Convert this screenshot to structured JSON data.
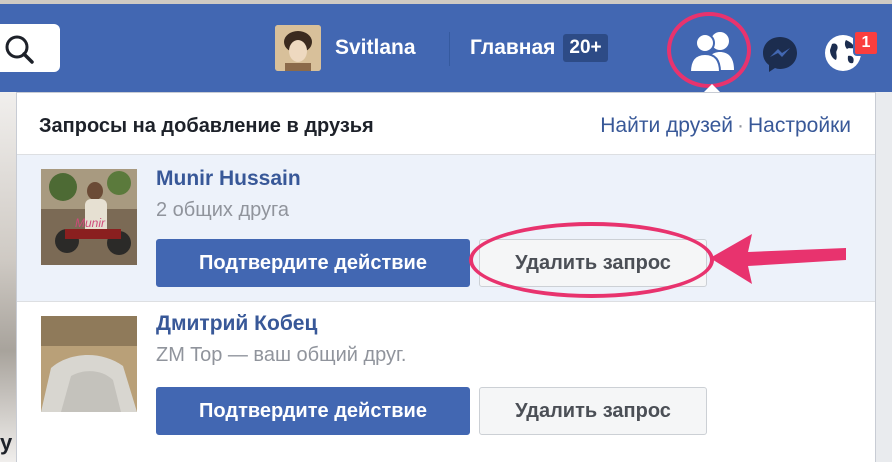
{
  "topbar": {
    "profile_name": "Svitlana",
    "home_label": "Главная",
    "home_badge": "20+",
    "notification_count": "1"
  },
  "panel": {
    "title": "Запросы на добавление в друзья",
    "find_friends": "Найти друзей",
    "separator": "·",
    "settings": "Настройки"
  },
  "requests": [
    {
      "name": "Munir Hussain",
      "mutual": "2 общих друга",
      "confirm_label": "Подтвердите действие",
      "delete_label": "Удалить запрос",
      "photo_caption": "Munir"
    },
    {
      "name": "Дмитрий Кобец",
      "mutual": "ZM Top — ваш общий друг.",
      "confirm_label": "Подтвердите действие",
      "delete_label": "Удалить запрос"
    }
  ],
  "background": {
    "left_glyph": "у"
  },
  "colors": {
    "topbar": "#4267b2",
    "link": "#385898",
    "highlight": "#e8336e",
    "badge": "#fa3e3e"
  }
}
